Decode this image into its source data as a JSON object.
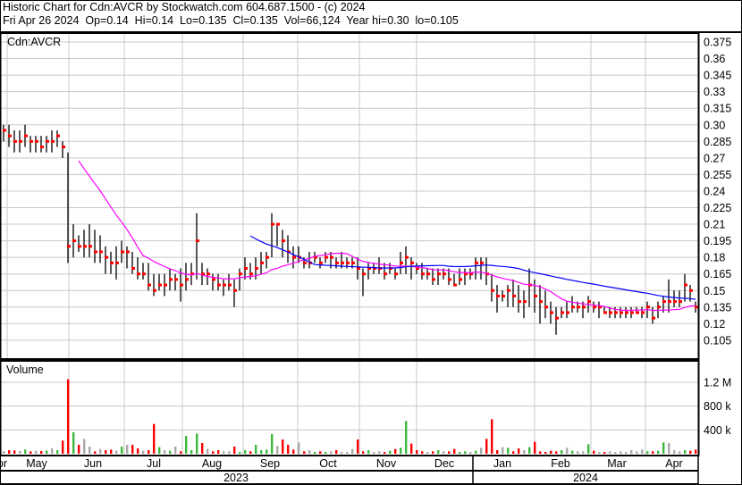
{
  "header": {
    "title": "Historic Chart for Cdn:AVCR by Stockwatch.com 604.687.1500 - (c) 2024",
    "quote": "Fri Apr 26 2024  Op=0.14  Hi=0.14  Lo=0.135  Cl=0.135  Vol=66,124  Year hi=0.30  lo=0.105"
  },
  "colors": {
    "up": "#3cb83c",
    "down": "#ff0000",
    "flat": "#a8a8a8",
    "ma_short": "#ff00ff",
    "ma_long": "#0000ff",
    "grid": "#c8c8c8"
  },
  "chart_data": {
    "type": "ohlc",
    "symbol_label": "Cdn:AVCR",
    "price_ticks": [
      "0.375",
      "0.36",
      "0.345",
      "0.33",
      "0.315",
      "0.30",
      "0.285",
      "0.27",
      "0.255",
      "0.24",
      "0.225",
      "0.21",
      "0.195",
      "0.18",
      "0.165",
      "0.15",
      "0.135",
      "0.12",
      "0.105"
    ],
    "ylim": [
      0.105,
      0.375
    ],
    "volume_label": "Volume",
    "volume_ticks": [
      {
        "label": "1.2 M",
        "value": 1200
      },
      {
        "label": "800 k",
        "value": 800
      },
      {
        "label": "400 k",
        "value": 400
      }
    ],
    "months": [
      "pr",
      "May",
      "Jun",
      "Jul",
      "Aug",
      "Sep",
      "Oct",
      "Nov",
      "Dec",
      "Jan",
      "Feb",
      "Mar",
      "Apr"
    ],
    "years": [
      "2023",
      "2024"
    ],
    "ma_periods": [
      15,
      47
    ],
    "bars_hi_lo_close": [
      [
        0.3,
        0.285,
        0.295
      ],
      [
        0.3,
        0.28,
        0.29
      ],
      [
        0.295,
        0.275,
        0.285
      ],
      [
        0.295,
        0.275,
        0.285
      ],
      [
        0.3,
        0.28,
        0.29
      ],
      [
        0.29,
        0.275,
        0.285
      ],
      [
        0.29,
        0.275,
        0.285
      ],
      [
        0.29,
        0.275,
        0.28
      ],
      [
        0.29,
        0.275,
        0.285
      ],
      [
        0.295,
        0.275,
        0.285
      ],
      [
        0.295,
        0.28,
        0.29
      ],
      [
        0.285,
        0.27,
        0.28
      ],
      [
        0.275,
        0.175,
        0.19
      ],
      [
        0.21,
        0.18,
        0.195
      ],
      [
        0.2,
        0.185,
        0.19
      ],
      [
        0.205,
        0.18,
        0.19
      ],
      [
        0.21,
        0.18,
        0.19
      ],
      [
        0.205,
        0.175,
        0.185
      ],
      [
        0.2,
        0.175,
        0.185
      ],
      [
        0.19,
        0.165,
        0.18
      ],
      [
        0.185,
        0.165,
        0.175
      ],
      [
        0.19,
        0.16,
        0.175
      ],
      [
        0.195,
        0.175,
        0.185
      ],
      [
        0.19,
        0.17,
        0.185
      ],
      [
        0.185,
        0.165,
        0.17
      ],
      [
        0.18,
        0.16,
        0.165
      ],
      [
        0.175,
        0.16,
        0.165
      ],
      [
        0.175,
        0.15,
        0.155
      ],
      [
        0.165,
        0.145,
        0.15
      ],
      [
        0.165,
        0.15,
        0.155
      ],
      [
        0.165,
        0.145,
        0.155
      ],
      [
        0.17,
        0.15,
        0.16
      ],
      [
        0.165,
        0.15,
        0.16
      ],
      [
        0.17,
        0.14,
        0.155
      ],
      [
        0.175,
        0.15,
        0.16
      ],
      [
        0.175,
        0.155,
        0.165
      ],
      [
        0.22,
        0.16,
        0.195
      ],
      [
        0.175,
        0.155,
        0.165
      ],
      [
        0.17,
        0.155,
        0.165
      ],
      [
        0.165,
        0.15,
        0.16
      ],
      [
        0.165,
        0.15,
        0.155
      ],
      [
        0.16,
        0.145,
        0.155
      ],
      [
        0.165,
        0.15,
        0.155
      ],
      [
        0.16,
        0.135,
        0.15
      ],
      [
        0.17,
        0.15,
        0.165
      ],
      [
        0.18,
        0.16,
        0.17
      ],
      [
        0.175,
        0.16,
        0.165
      ],
      [
        0.18,
        0.16,
        0.17
      ],
      [
        0.185,
        0.165,
        0.175
      ],
      [
        0.185,
        0.17,
        0.18
      ],
      [
        0.22,
        0.18,
        0.21
      ],
      [
        0.21,
        0.19,
        0.21
      ],
      [
        0.205,
        0.18,
        0.195
      ],
      [
        0.2,
        0.175,
        0.185
      ],
      [
        0.19,
        0.17,
        0.18
      ],
      [
        0.19,
        0.175,
        0.18
      ],
      [
        0.18,
        0.17,
        0.175
      ],
      [
        0.185,
        0.17,
        0.175
      ],
      [
        0.185,
        0.175,
        0.18
      ],
      [
        0.18,
        0.17,
        0.175
      ],
      [
        0.185,
        0.175,
        0.18
      ],
      [
        0.185,
        0.17,
        0.18
      ],
      [
        0.18,
        0.17,
        0.175
      ],
      [
        0.185,
        0.17,
        0.175
      ],
      [
        0.18,
        0.17,
        0.175
      ],
      [
        0.18,
        0.17,
        0.175
      ],
      [
        0.18,
        0.16,
        0.17
      ],
      [
        0.17,
        0.145,
        0.165
      ],
      [
        0.175,
        0.16,
        0.17
      ],
      [
        0.175,
        0.165,
        0.17
      ],
      [
        0.18,
        0.165,
        0.17
      ],
      [
        0.175,
        0.16,
        0.165
      ],
      [
        0.175,
        0.165,
        0.17
      ],
      [
        0.17,
        0.16,
        0.165
      ],
      [
        0.185,
        0.165,
        0.175
      ],
      [
        0.19,
        0.165,
        0.18
      ],
      [
        0.18,
        0.16,
        0.175
      ],
      [
        0.175,
        0.165,
        0.17
      ],
      [
        0.175,
        0.16,
        0.165
      ],
      [
        0.17,
        0.16,
        0.165
      ],
      [
        0.17,
        0.155,
        0.16
      ],
      [
        0.17,
        0.155,
        0.165
      ],
      [
        0.17,
        0.16,
        0.165
      ],
      [
        0.17,
        0.155,
        0.16
      ],
      [
        0.165,
        0.155,
        0.155
      ],
      [
        0.17,
        0.155,
        0.16
      ],
      [
        0.17,
        0.155,
        0.165
      ],
      [
        0.17,
        0.16,
        0.165
      ],
      [
        0.18,
        0.16,
        0.175
      ],
      [
        0.18,
        0.16,
        0.175
      ],
      [
        0.18,
        0.155,
        0.165
      ],
      [
        0.165,
        0.14,
        0.15
      ],
      [
        0.155,
        0.13,
        0.145
      ],
      [
        0.15,
        0.14,
        0.145
      ],
      [
        0.155,
        0.135,
        0.15
      ],
      [
        0.16,
        0.135,
        0.145
      ],
      [
        0.155,
        0.13,
        0.14
      ],
      [
        0.15,
        0.125,
        0.14
      ],
      [
        0.17,
        0.135,
        0.155
      ],
      [
        0.16,
        0.13,
        0.145
      ],
      [
        0.155,
        0.12,
        0.14
      ],
      [
        0.15,
        0.125,
        0.135
      ],
      [
        0.14,
        0.12,
        0.13
      ],
      [
        0.135,
        0.11,
        0.125
      ],
      [
        0.135,
        0.125,
        0.13
      ],
      [
        0.14,
        0.125,
        0.13
      ],
      [
        0.145,
        0.13,
        0.135
      ],
      [
        0.14,
        0.13,
        0.135
      ],
      [
        0.14,
        0.125,
        0.135
      ],
      [
        0.145,
        0.13,
        0.14
      ],
      [
        0.14,
        0.13,
        0.135
      ],
      [
        0.14,
        0.125,
        0.135
      ],
      [
        0.135,
        0.13,
        0.13
      ],
      [
        0.135,
        0.125,
        0.13
      ],
      [
        0.135,
        0.125,
        0.13
      ],
      [
        0.135,
        0.125,
        0.13
      ],
      [
        0.135,
        0.125,
        0.13
      ],
      [
        0.135,
        0.125,
        0.13
      ],
      [
        0.135,
        0.13,
        0.13
      ],
      [
        0.135,
        0.125,
        0.13
      ],
      [
        0.14,
        0.125,
        0.135
      ],
      [
        0.135,
        0.12,
        0.125
      ],
      [
        0.14,
        0.125,
        0.135
      ],
      [
        0.145,
        0.13,
        0.14
      ],
      [
        0.16,
        0.13,
        0.14
      ],
      [
        0.15,
        0.135,
        0.14
      ],
      [
        0.15,
        0.135,
        0.14
      ],
      [
        0.165,
        0.14,
        0.155
      ],
      [
        0.155,
        0.14,
        0.15
      ],
      [
        0.14,
        0.13,
        0.135
      ]
    ],
    "volume_k": [
      40,
      60,
      55,
      45,
      70,
      40,
      50,
      45,
      55,
      90,
      60,
      220,
      1250,
      360,
      150,
      250,
      120,
      40,
      80,
      60,
      70,
      50,
      120,
      150,
      150,
      90,
      50,
      60,
      500,
      110,
      60,
      50,
      120,
      40,
      300,
      60,
      340,
      180,
      80,
      40,
      60,
      40,
      40,
      120,
      30,
      60,
      40,
      150,
      60,
      70,
      330,
      130,
      240,
      150,
      70,
      190,
      40,
      60,
      30,
      40,
      30,
      40,
      60,
      30,
      30,
      80,
      240,
      40,
      60,
      30,
      40,
      30,
      50,
      80,
      100,
      550,
      170,
      60,
      40,
      30,
      40,
      60,
      40,
      40,
      80,
      30,
      40,
      30,
      50,
      100,
      250,
      580,
      60,
      110,
      100,
      40,
      90,
      60,
      110,
      200,
      40,
      30,
      50,
      40,
      60,
      100,
      50,
      40,
      40,
      160,
      50,
      30,
      30,
      40,
      30,
      40,
      30,
      60,
      40,
      70,
      40,
      40,
      50,
      190,
      180,
      60,
      40,
      60,
      50,
      70
    ]
  }
}
